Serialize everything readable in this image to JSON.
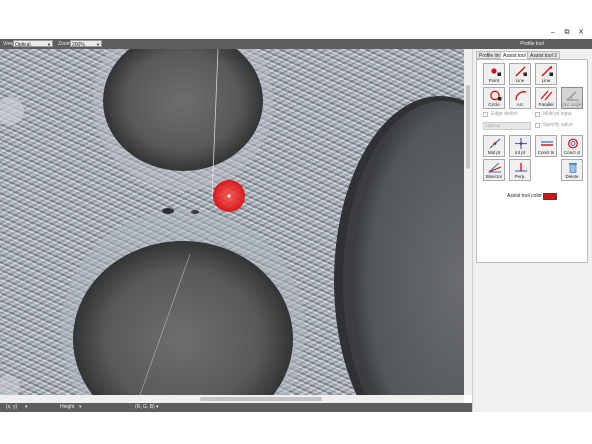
{
  "window": {
    "title": "Profile tool",
    "controls": {
      "minimize": "–",
      "maximize": "⧉",
      "close": "✕"
    }
  },
  "toolbar": {
    "view_label": "View",
    "view_value": "Optical",
    "zoom_label": "Zoom",
    "zoom_value": "200%"
  },
  "statusbar": {
    "xy": "(x, y)",
    "height": "Height",
    "rgb": "(R, G, B)"
  },
  "panel": {
    "tabs": [
      "Profile line",
      "Assist tool 1",
      "Assist tool 2"
    ],
    "active_tab": "Assist tool 1",
    "row1": [
      "Point",
      "Line",
      "Line"
    ],
    "row2": [
      "Circle",
      "Arc",
      "Parallel",
      "Spc angle"
    ],
    "edge_detect": "Edge detect",
    "multi_pt_input": "Multi-pt input",
    "optical": "Optical",
    "specify_value": "Specify value",
    "row3": [
      "Mid pt",
      "Int pt",
      "Conct ln",
      "Conct cl"
    ],
    "row4": [
      "Bisector",
      "Perp.",
      "Delete"
    ],
    "assist_color_label": "Assist tool color",
    "assist_color": "#e01010"
  },
  "icons": {
    "point": "point-icon",
    "line": "line-icon",
    "circle": "circle-icon",
    "arc": "arc-icon",
    "parallel": "parallel-icon",
    "angle": "angle-icon",
    "mid": "midpoint-icon",
    "intersection": "intersection-icon",
    "conct_line": "connect-line-icon",
    "conct_circle": "connect-circle-icon",
    "bisector": "bisector-icon",
    "perp": "perpendicular-icon",
    "delete": "trash-icon"
  }
}
